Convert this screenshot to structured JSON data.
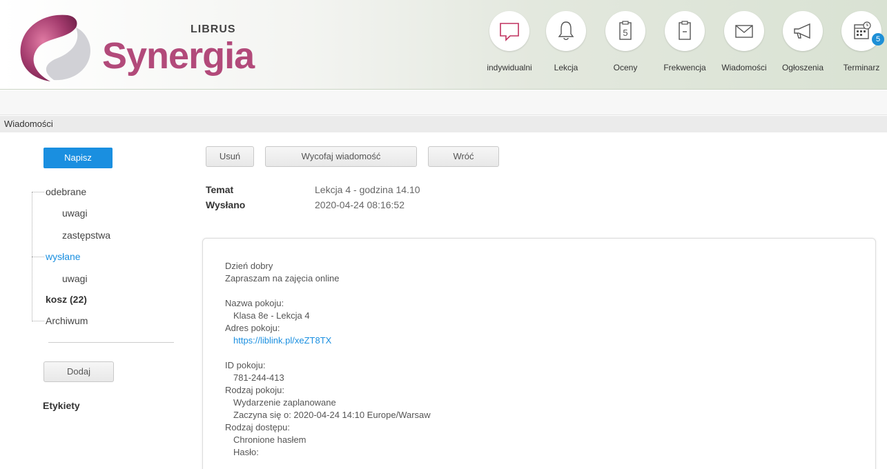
{
  "brand": {
    "name": "Synergia",
    "sub": "LIBRUS"
  },
  "nav": [
    {
      "label": "indywidualni",
      "icon": "chat-bubble-icon"
    },
    {
      "label": "Lekcja",
      "icon": "bell-icon"
    },
    {
      "label": "Oceny",
      "icon": "grade-icon"
    },
    {
      "label": "Frekwencja",
      "icon": "clipboard-icon"
    },
    {
      "label": "Wiadomości",
      "icon": "envelope-icon"
    },
    {
      "label": "Ogłoszenia",
      "icon": "megaphone-icon"
    },
    {
      "label": "Terminarz",
      "icon": "calendar-icon",
      "badge": "5"
    }
  ],
  "section_title": "Wiadomości",
  "sidebar": {
    "compose": "Napisz",
    "folders": [
      {
        "label": "odebrane"
      },
      {
        "label": "uwagi"
      },
      {
        "label": "zastępstwa"
      },
      {
        "label": "wysłane"
      },
      {
        "label": "uwagi"
      },
      {
        "label": "kosz (22)"
      },
      {
        "label": "Archiwum"
      }
    ],
    "add": "Dodaj",
    "labels_heading": "Etykiety"
  },
  "toolbar": {
    "delete": "Usuń",
    "withdraw": "Wycofaj wiadomość",
    "back": "Wróć"
  },
  "message": {
    "subject_label": "Temat",
    "subject": "Lekcja 4 - godzina 14.10",
    "sent_label": "Wysłano",
    "sent": "2020-04-24 08:16:52",
    "body": [
      "Dzień dobry",
      "Zapraszam na zajęcia online",
      "Nazwa pokoju:",
      "Klasa 8e - Lekcja 4",
      "Adres pokoju:",
      "https://liblink.pl/xeZT8TX",
      "ID pokoju:",
      "781-244-413",
      "Rodzaj pokoju:",
      "Wydarzenie zaplanowane",
      "Zaczyna się o: 2020-04-24 14:10 Europe/Warsaw",
      "Rodzaj dostępu:",
      "Chronione hasłem",
      "Hasło:"
    ]
  }
}
